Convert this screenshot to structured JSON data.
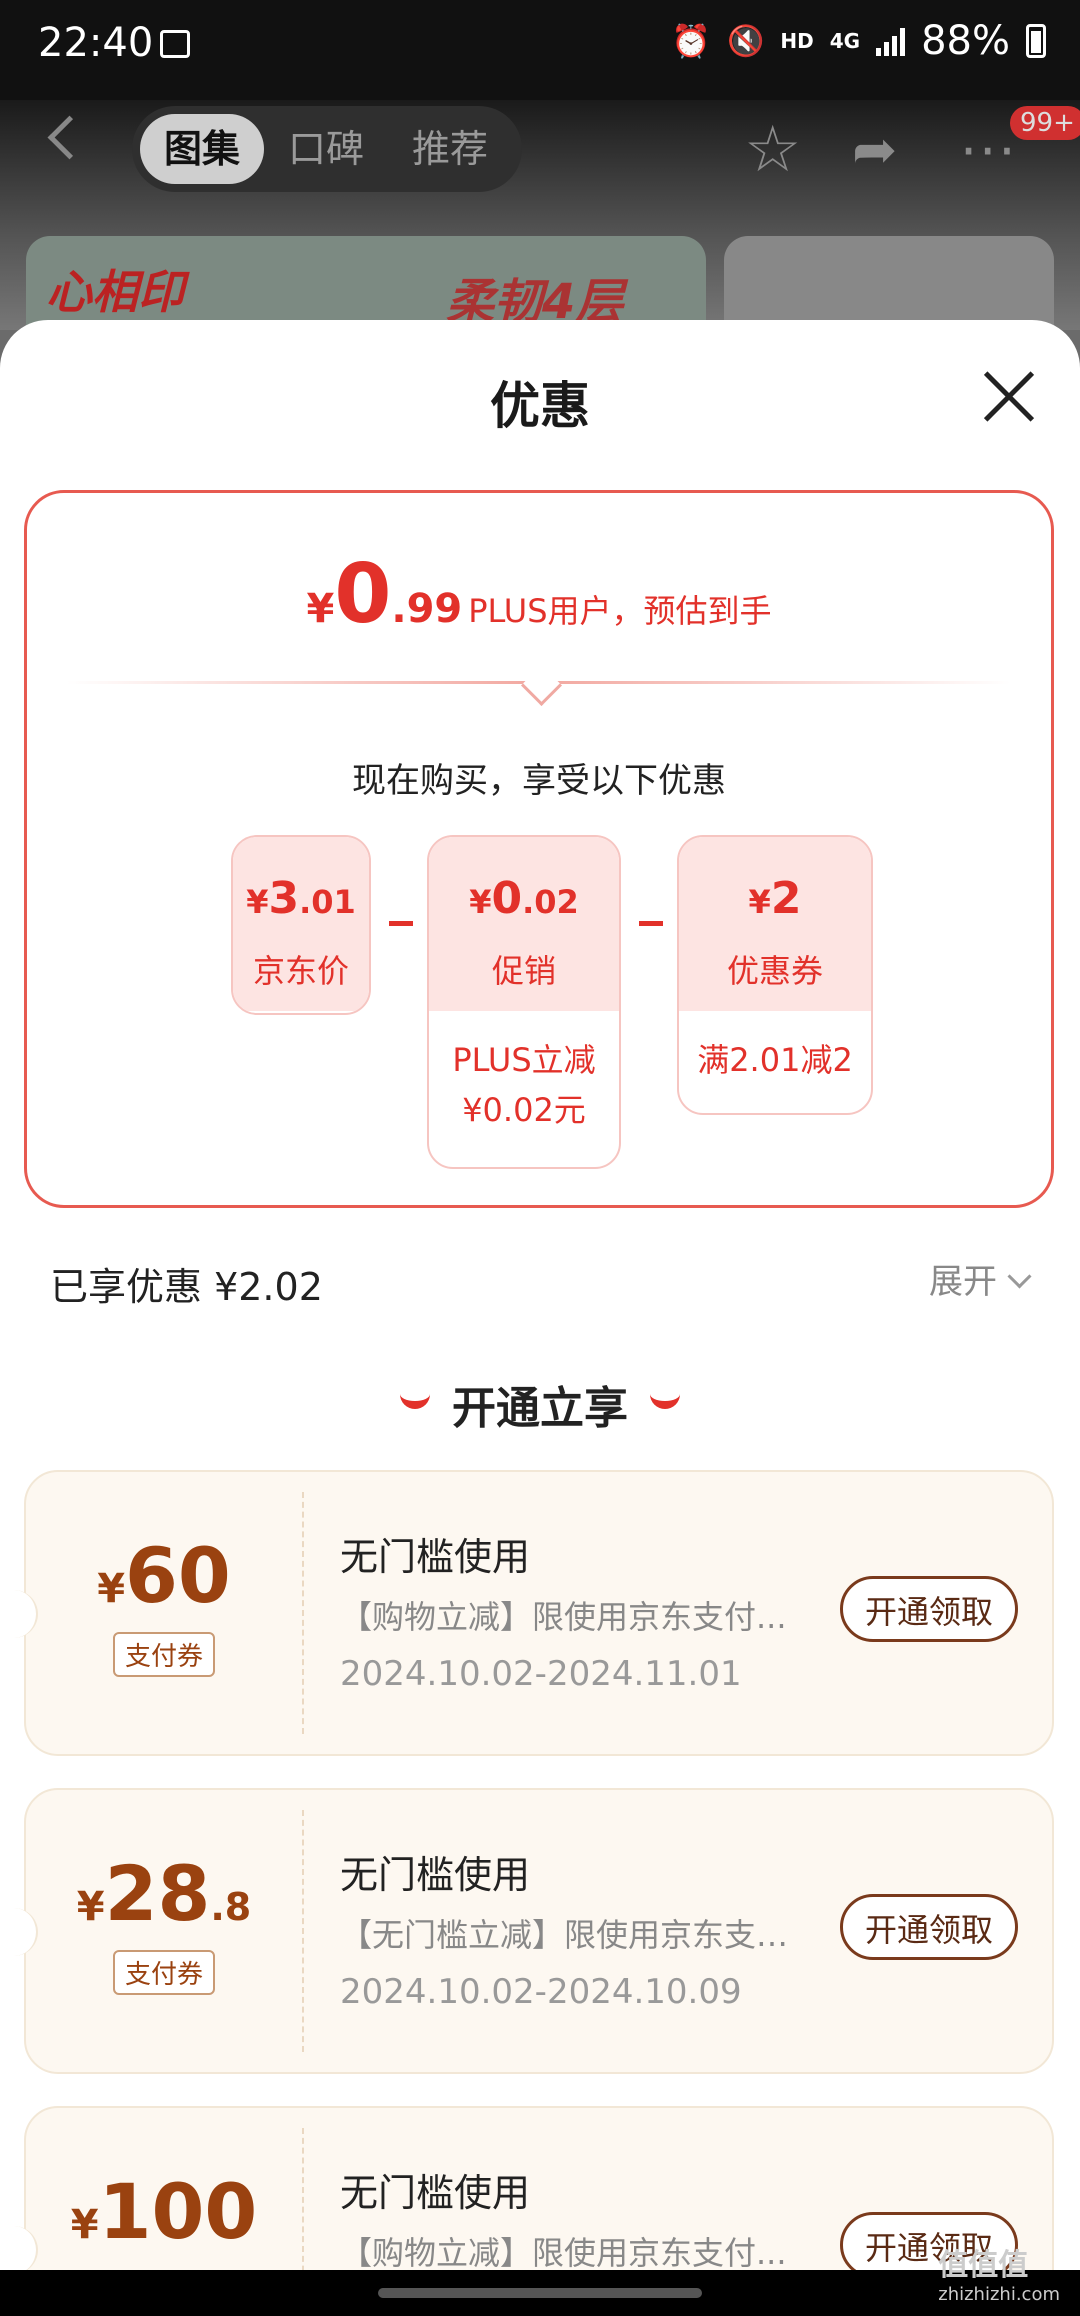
{
  "status_bar": {
    "time": "22:40",
    "network": "HD",
    "net_type": "4G",
    "battery": "88%"
  },
  "header": {
    "tabs": [
      "图集",
      "口碑",
      "推荐"
    ],
    "badge": "99+"
  },
  "banner": {
    "logo_text": "心相印",
    "slogan": "柔韧4层"
  },
  "sheet": {
    "title": "优惠",
    "final_price": {
      "currency": "¥",
      "integer": "0",
      "decimal": ".99",
      "desc": "PLUS用户，预估到手"
    },
    "buy_text": "现在购买，享受以下优惠",
    "breakdown": [
      {
        "currency": "¥",
        "integer": "3",
        "decimal": ".01",
        "label": "京东价"
      },
      {
        "currency": "¥",
        "integer": "0",
        "decimal": ".02",
        "label": "促销",
        "note_line1": "PLUS立减",
        "note_line2": "¥0.02元"
      },
      {
        "currency": "¥",
        "integer": "2",
        "decimal": "",
        "label": "优惠券",
        "note_line1": "满2.01减2"
      }
    ],
    "enjoyed": "已享优惠 ¥2.02",
    "expand": "展开",
    "open_title": "开通立享"
  },
  "coupons": [
    {
      "currency": "¥",
      "integer": "60",
      "decimal": "",
      "tag": "支付券",
      "title": "无门槛使用",
      "desc": "【购物立减】限使用京东支付...",
      "date": "2024.10.02-2024.11.01",
      "button": "开通领取"
    },
    {
      "currency": "¥",
      "integer": "28",
      "decimal": ".8",
      "tag": "支付券",
      "title": "无门槛使用",
      "desc": "【无门槛立减】限使用京东支付...",
      "date": "2024.10.02-2024.10.09",
      "button": "开通领取"
    },
    {
      "currency": "¥",
      "integer": "100",
      "decimal": "",
      "tag": "",
      "title": "无门槛使用",
      "desc": "【购物立减】限使用京东支付...",
      "date": "",
      "button": "开通领取"
    }
  ],
  "watermark": {
    "main": "值值值",
    "sub": "zhizhizhi.com"
  },
  "colors": {
    "accent_red": "#e2312a",
    "coupon_brown": "#9a4210"
  }
}
